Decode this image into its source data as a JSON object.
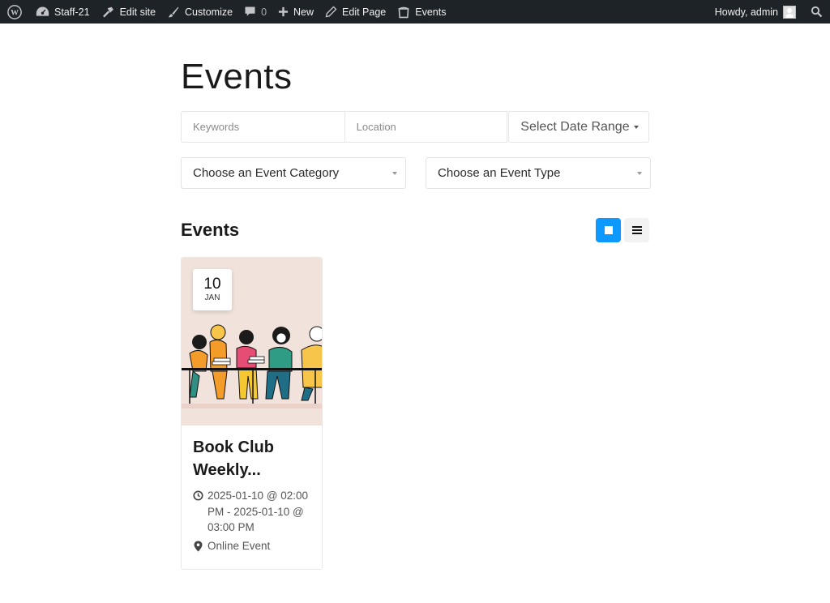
{
  "adminbar": {
    "site_name": "Staff-21",
    "edit_site": "Edit site",
    "customize": "Customize",
    "comments_count": "0",
    "new": "New",
    "edit_page": "Edit Page",
    "events": "Events",
    "greeting": "Howdy, admin"
  },
  "page": {
    "title": "Events"
  },
  "filters": {
    "keywords_placeholder": "Keywords",
    "location_placeholder": "Location",
    "date_range": "Select Date Range",
    "category_select": "Choose an Event Category",
    "type_select": "Choose an Event Type"
  },
  "events_section": {
    "heading": "Events",
    "view_mode": "grid"
  },
  "events": [
    {
      "day": "10",
      "month": "JAN",
      "title": "Book Club Weekly...",
      "datetime": "2025-01-10 @ 02:00 PM - 2025-01-10 @ 03:00 PM",
      "location": "Online Event"
    }
  ],
  "colors": {
    "adminbar_bg": "#1d2327",
    "accent": "#0d99ff",
    "card_image_bg": "#f1e3dc"
  }
}
